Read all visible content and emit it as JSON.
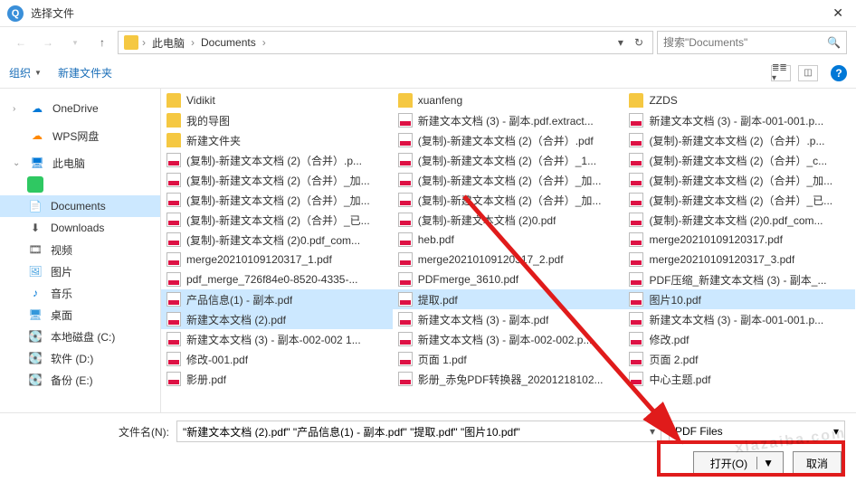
{
  "window": {
    "title": "选择文件"
  },
  "nav": {
    "breadcrumbs": [
      "此电脑",
      "Documents"
    ],
    "search_placeholder": "搜索\"Documents\""
  },
  "toolbar": {
    "organize": "组织",
    "new_folder": "新建文件夹"
  },
  "sidebar": {
    "onedrive": "OneDrive",
    "wps": "WPS网盘",
    "pc": "此电脑",
    "documents": "Documents",
    "downloads": "Downloads",
    "video": "视频",
    "pictures": "图片",
    "music": "音乐",
    "desktop": "桌面",
    "disk_c": "本地磁盘 (C:)",
    "disk_d": "软件 (D:)",
    "disk_e": "备份 (E:)"
  },
  "files": {
    "col1": [
      {
        "t": "folder",
        "n": "Vidikit"
      },
      {
        "t": "folder",
        "n": "我的导图"
      },
      {
        "t": "folder",
        "n": "新建文件夹"
      },
      {
        "t": "pdf",
        "n": "(复制)-新建文本文档 (2)（合并）.p..."
      },
      {
        "t": "pdf",
        "n": "(复制)-新建文本文档 (2)（合并）_加..."
      },
      {
        "t": "pdf",
        "n": "(复制)-新建文本文档 (2)（合并）_加..."
      },
      {
        "t": "pdf",
        "n": "(复制)-新建文本文档 (2)（合并）_已..."
      },
      {
        "t": "pdf",
        "n": "(复制)-新建文本文档 (2)0.pdf_com..."
      },
      {
        "t": "pdf",
        "n": "merge20210109120317_1.pdf"
      },
      {
        "t": "pdf",
        "n": "pdf_merge_726f84e0-8520-4335-..."
      },
      {
        "t": "pdf",
        "n": "产品信息(1) - 副本.pdf",
        "sel": true
      },
      {
        "t": "pdf",
        "n": "新建文本文档 (2).pdf",
        "sel": true
      },
      {
        "t": "pdf",
        "n": "新建文本文档 (3) - 副本-002-002 1..."
      },
      {
        "t": "pdf",
        "n": "修改-001.pdf"
      },
      {
        "t": "pdf",
        "n": "影册.pdf"
      }
    ],
    "col2": [
      {
        "t": "folder",
        "n": "xuanfeng"
      },
      {
        "t": "pdf",
        "n": "新建文本文档 (3) - 副本.pdf.extract..."
      },
      {
        "t": "pdf",
        "n": "(复制)-新建文本文档 (2)（合并）.pdf"
      },
      {
        "t": "pdf",
        "n": "(复制)-新建文本文档 (2)（合并）_1..."
      },
      {
        "t": "pdf",
        "n": "(复制)-新建文本文档 (2)（合并）_加..."
      },
      {
        "t": "pdf",
        "n": "(复制)-新建文本文档 (2)（合并）_加..."
      },
      {
        "t": "pdf",
        "n": "(复制)-新建文本文档 (2)0.pdf"
      },
      {
        "t": "pdf",
        "n": "heb.pdf"
      },
      {
        "t": "pdf",
        "n": "merge20210109120317_2.pdf"
      },
      {
        "t": "pdf",
        "n": "PDFmerge_3610.pdf"
      },
      {
        "t": "pdf",
        "n": "提取.pdf",
        "sel": true
      },
      {
        "t": "pdf",
        "n": "新建文本文档 (3) - 副本.pdf"
      },
      {
        "t": "pdf",
        "n": "新建文本文档 (3) - 副本-002-002.p..."
      },
      {
        "t": "pdf",
        "n": "页面 1.pdf"
      },
      {
        "t": "pdf",
        "n": "影册_赤兔PDF转换器_20201218102..."
      }
    ],
    "col3": [
      {
        "t": "folder",
        "n": "ZZDS"
      },
      {
        "t": "pdf",
        "n": "新建文本文档 (3) - 副本-001-001.p..."
      },
      {
        "t": "pdf",
        "n": "(复制)-新建文本文档 (2)（合并）.p..."
      },
      {
        "t": "pdf",
        "n": "(复制)-新建文本文档 (2)（合并）_c..."
      },
      {
        "t": "pdf",
        "n": "(复制)-新建文本文档 (2)（合并）_加..."
      },
      {
        "t": "pdf",
        "n": "(复制)-新建文本文档 (2)（合并）_已..."
      },
      {
        "t": "pdf",
        "n": "(复制)-新建文本文档 (2)0.pdf_com..."
      },
      {
        "t": "pdf",
        "n": "merge20210109120317.pdf"
      },
      {
        "t": "pdf",
        "n": "merge20210109120317_3.pdf"
      },
      {
        "t": "pdf",
        "n": "PDF压缩_新建文本文档 (3) - 副本_..."
      },
      {
        "t": "pdf",
        "n": "图片10.pdf",
        "sel": true
      },
      {
        "t": "pdf",
        "n": "新建文本文档 (3) - 副本-001-001.p..."
      },
      {
        "t": "pdf",
        "n": "修改.pdf"
      },
      {
        "t": "pdf",
        "n": "页面 2.pdf"
      },
      {
        "t": "pdf",
        "n": "中心主题.pdf"
      }
    ]
  },
  "bottom": {
    "filename_label": "文件名(N):",
    "filename_value": "\"新建文本文档 (2).pdf\" \"产品信息(1) - 副本.pdf\" \"提取.pdf\" \"图片10.pdf\"",
    "filter": "PDF Files",
    "open": "打开(O)",
    "cancel": "取消"
  },
  "watermark": "xiazaiba.com"
}
